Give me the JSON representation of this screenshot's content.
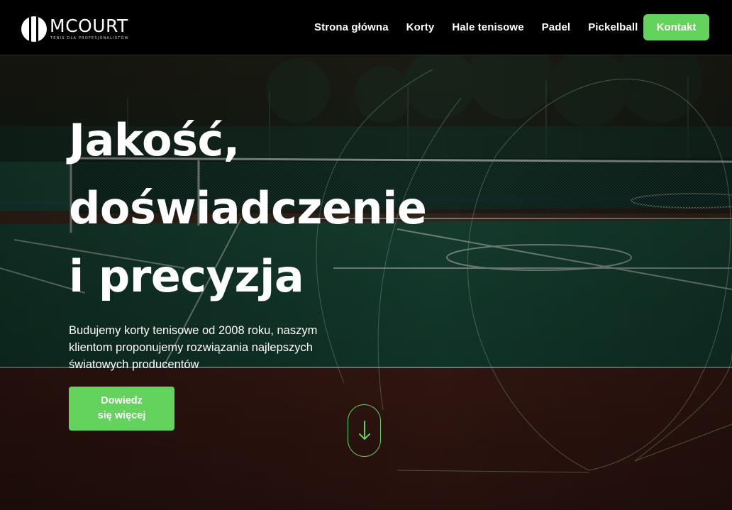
{
  "header": {
    "logo": {
      "name": "MCOURT",
      "tagline": "TENIS DLA PROFESJONALISTÓW"
    },
    "nav": [
      {
        "label": "Strona główna"
      },
      {
        "label": "Korty"
      },
      {
        "label": "Hale tenisowe"
      },
      {
        "label": "Padel"
      },
      {
        "label": "Pickelball"
      }
    ],
    "contact_label": "Kontakt"
  },
  "hero": {
    "title_lines": [
      "Jakość,",
      "doświadczenie",
      "i precyzja"
    ],
    "description": "Budujemy korty tenisowe od 2008 roku, naszym klientom proponujemy rozwiązania najlepszych światowych producentów",
    "cta_lines": [
      "Dowiedz",
      "się więcej"
    ],
    "scroll_icon": "arrow-down-icon"
  },
  "colors": {
    "accent": "#63d35d",
    "header_bg": "#000000",
    "court_green": "#1f5c45",
    "court_red": "#4a1f1a"
  }
}
